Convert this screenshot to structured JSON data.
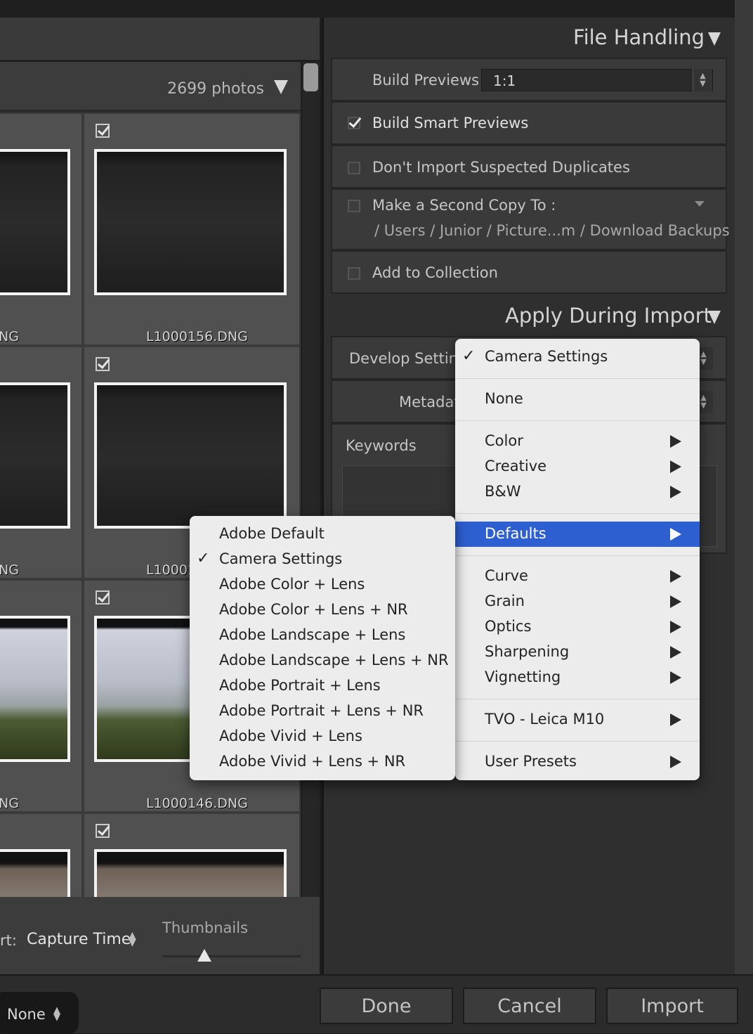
{
  "left": {
    "photo_count": "2699 photos",
    "filenames": [
      "NG",
      "L1000156.DNG",
      "NG",
      "L10001",
      "NG",
      "L1000146.DNG"
    ],
    "sort_label": "rt:",
    "sort_value": "Capture Time",
    "thumbnails_label": "Thumbnails",
    "thumbnail_size_level": 0.3,
    "preset_select": "None"
  },
  "file_handling": {
    "title": "File Handling",
    "build_previews_label": "Build Previews",
    "build_previews_value": "1:1",
    "build_smart_previews": "Build Smart Previews",
    "build_smart_previews_checked": true,
    "dont_import_duplicates": "Don't Import Suspected Duplicates",
    "dont_import_duplicates_checked": false,
    "second_copy": "Make a Second Copy To :",
    "second_copy_checked": false,
    "second_copy_path": "/ Users / Junior / Picture...m / Download Backups",
    "add_to_collection": "Add to Collection",
    "add_to_collection_checked": false
  },
  "apply_during_import": {
    "title": "Apply During Import",
    "develop_settings_label": "Develop Setting",
    "metadata_label": "Metadat",
    "keywords_label": "Keywords"
  },
  "develop_menu": {
    "checked_item": "Camera Settings",
    "none": "None",
    "group1": [
      "Color",
      "Creative",
      "B&W"
    ],
    "highlighted": "Defaults",
    "group2": [
      "Curve",
      "Grain",
      "Optics",
      "Sharpening",
      "Vignetting"
    ],
    "tvo": "TVO - Leica M10",
    "user_presets": "User Presets"
  },
  "defaults_submenu": {
    "items": [
      "Adobe Default",
      "Camera Settings",
      "Adobe Color + Lens",
      "Adobe Color + Lens + NR",
      "Adobe Landscape + Lens",
      "Adobe Landscape + Lens + NR",
      "Adobe Portrait + Lens",
      "Adobe Portrait + Lens + NR",
      "Adobe Vivid + Lens",
      "Adobe Vivid + Lens + NR"
    ],
    "checked_index": 1
  },
  "buttons": {
    "done": "Done",
    "cancel": "Cancel",
    "import": "Import"
  },
  "colors": {
    "highlight": "#2e5fd1",
    "menu_bg": "#ececec",
    "panel_bg": "#2f2f2f"
  }
}
